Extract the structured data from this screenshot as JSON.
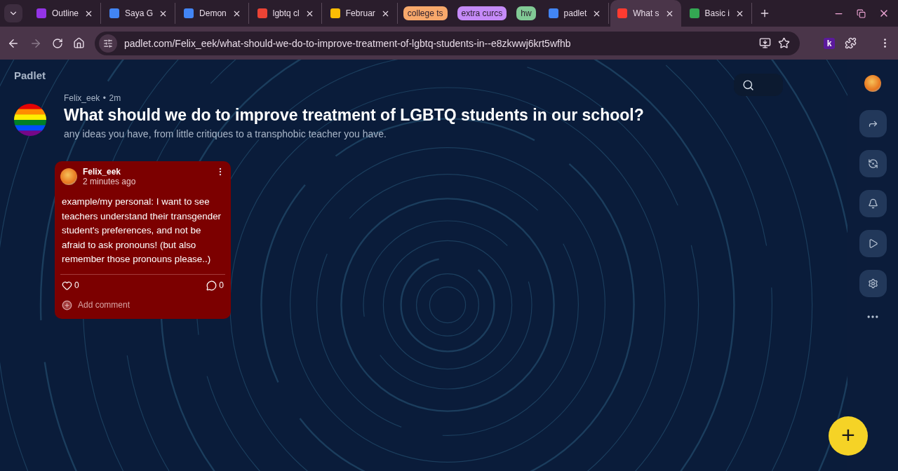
{
  "browser": {
    "tabs": [
      {
        "kind": "tab",
        "title": "Outline",
        "color": "#9334e6",
        "selected": false
      },
      {
        "kind": "tab",
        "title": "Saya G",
        "color": "#4285f4",
        "selected": false
      },
      {
        "kind": "tab",
        "title": "Demon",
        "color": "#4285f4",
        "selected": false
      },
      {
        "kind": "tab",
        "title": "lgbtq cl",
        "color": "#ea4335",
        "selected": false
      },
      {
        "kind": "tab",
        "title": "Februar",
        "color": "#fbbc04",
        "selected": false
      },
      {
        "kind": "group",
        "title": "college ts",
        "color": "#f7a86b"
      },
      {
        "kind": "group",
        "title": "extra curcs",
        "color": "#c58af9"
      },
      {
        "kind": "group",
        "title": "hw",
        "color": "#81c995"
      },
      {
        "kind": "tab",
        "title": "padlet",
        "color": "#4285f4",
        "selected": false
      },
      {
        "kind": "tab",
        "title": "What s",
        "color": "#ff3b30",
        "selected": true
      },
      {
        "kind": "tab",
        "title": "Basic i",
        "color": "#34a853",
        "selected": false
      }
    ],
    "url": "padlet.com/Felix_eek/what-should-we-do-to-improve-treatment-of-lgbtq-students-in--e8zkwwj6krt5wfhb",
    "extension_letter": "k"
  },
  "padlet": {
    "logo": "Padlet",
    "author": "Felix_eek",
    "separator": "•",
    "age": "2m",
    "title": "What should we do to improve treatment of LGBTQ students in our school?",
    "description": "any ideas you have, from little critiques to a transphobic teacher you have.",
    "posts": [
      {
        "author": "Felix_eek",
        "time": "2 minutes ago",
        "body": "example/my personal: I want to see teachers understand their transgender student's preferences, and not be afraid to ask pronouns! (but also remember those pronouns please..)",
        "likes": "0",
        "comments": "0",
        "comment_placeholder": "Add comment",
        "color": "#7c0000"
      }
    ],
    "add_button": "+"
  }
}
